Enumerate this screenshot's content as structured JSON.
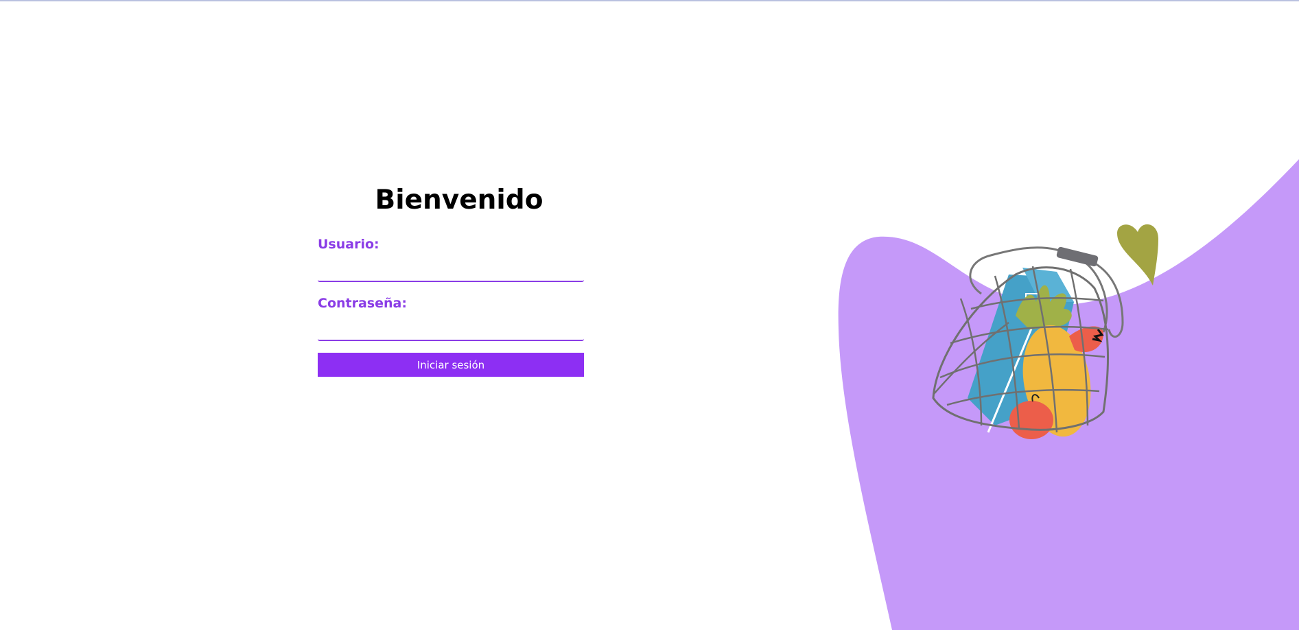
{
  "login": {
    "title": "Bienvenido",
    "username_label": "Usuario:",
    "username_value": "",
    "password_label": "Contraseña:",
    "password_value": "",
    "submit_label": "Iniciar sesión"
  },
  "illustration": {
    "icon": "grocery-bag-illustration"
  },
  "colors": {
    "accent": "#8a3ce6",
    "button": "#8d2ff3",
    "blob": "#c599f9",
    "background": "#ffffff"
  }
}
